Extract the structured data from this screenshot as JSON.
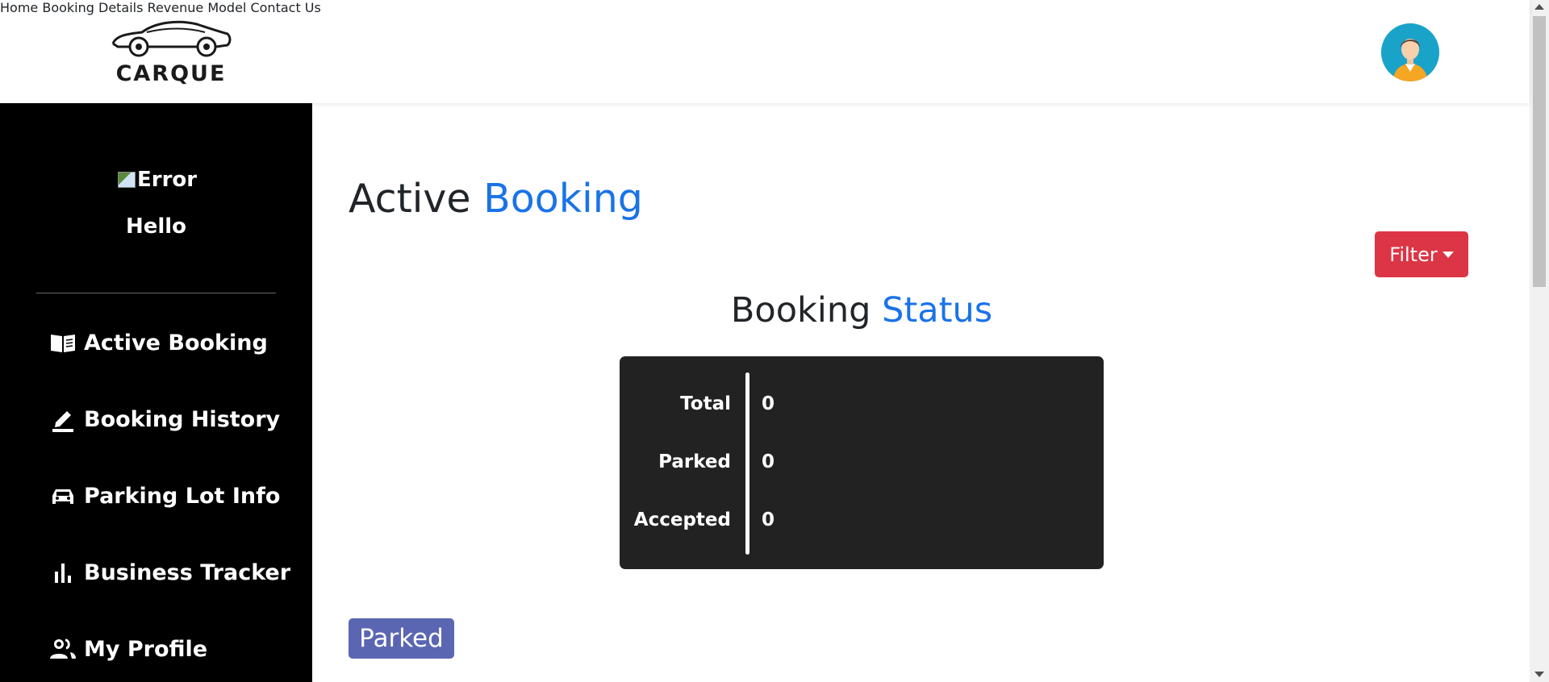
{
  "header": {
    "logo_text": "CARQUE",
    "nav": [
      {
        "label": "Home"
      },
      {
        "label": "Booking Details"
      },
      {
        "label": "Revenue Model"
      },
      {
        "label": "Contact Us"
      }
    ]
  },
  "sidebar": {
    "image_alt": "Error",
    "greeting": "Hello",
    "items": [
      {
        "label": "Active Booking",
        "icon": "book-open-icon"
      },
      {
        "label": "Booking History",
        "icon": "pencil-icon"
      },
      {
        "label": "Parking Lot Info",
        "icon": "car-icon"
      },
      {
        "label": "Business Tracker",
        "icon": "bar-chart-icon"
      },
      {
        "label": "My Profile",
        "icon": "people-icon"
      }
    ]
  },
  "main": {
    "title_part1": "Active",
    "title_part2": "Booking",
    "filter_label": "Filter",
    "subtitle_part1": "Booking",
    "subtitle_part2": "Status",
    "status": [
      {
        "label": "Total",
        "value": "0"
      },
      {
        "label": "Parked",
        "value": "0"
      },
      {
        "label": "Accepted",
        "value": "0"
      }
    ],
    "parked_badge": "Parked"
  },
  "colors": {
    "accent": "#1a73e8",
    "filter": "#dc3545",
    "badge": "#5b66b3",
    "sidebar_bg": "#000000",
    "card_bg": "#222222"
  }
}
